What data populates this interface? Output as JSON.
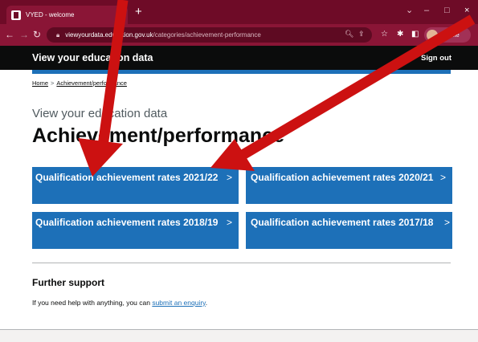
{
  "browser": {
    "tab_title": "VYED - welcome",
    "tab_close": "×",
    "new_tab": "+",
    "window_controls": {
      "dropdown": "⌄",
      "minimize": "–",
      "maximize": "□",
      "close": "×"
    },
    "url_host": "viewyourdata.education.gov.uk",
    "url_path": "/categories/achievement-performance",
    "profile_label": "Profile"
  },
  "site": {
    "name": "View your education data",
    "sign_out": "Sign out"
  },
  "breadcrumb": {
    "home": "Home",
    "separator": ">",
    "current": "Achievement/performance"
  },
  "page": {
    "caption": "View your education data",
    "title": "Achievement/performance"
  },
  "cards": [
    {
      "title": "Qualification achievement rates 2021/22",
      "chevron": ">"
    },
    {
      "title": "Qualification achievement rates 2020/21",
      "chevron": ">"
    },
    {
      "title": "Qualification achievement rates 2018/19",
      "chevron": ">"
    },
    {
      "title": "Qualification achievement rates 2017/18",
      "chevron": ">"
    }
  ],
  "support": {
    "heading": "Further support",
    "text": "If you need help with anything, you can ",
    "link": "submit an enquiry",
    "end": "."
  },
  "colors": {
    "browser_frame": "#6e0b27",
    "header": "#0b0c0c",
    "accent_blue": "#1d70b8",
    "annotation_arrow": "#cc1111"
  }
}
